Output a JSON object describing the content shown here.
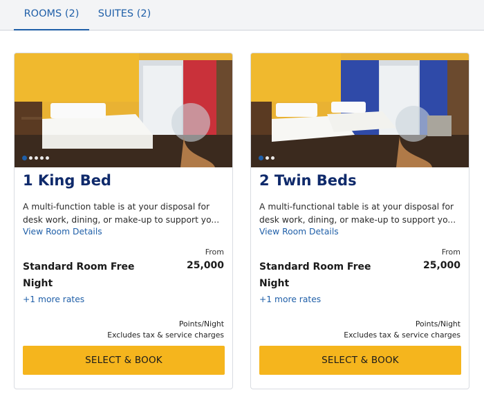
{
  "tabs": [
    {
      "label": "ROOMS (2)",
      "active": true
    },
    {
      "label": "SUITES (2)",
      "active": false
    }
  ],
  "rooms": [
    {
      "title": "1 King Bed",
      "description": "A multi-function table is at your disposal for desk work, dining, or make-up to support yo...",
      "view_details": "View Room Details",
      "from_label": "From",
      "points": "25,000",
      "rate_name": "Standard Room Free Night",
      "more_rates": "+1 more rates",
      "per_night": "Points/Night",
      "excludes": "Excludes tax & service charges",
      "cta": "SELECT & BOOK",
      "photo_dots": 5,
      "photo_active_dot": 0,
      "mural_color": "#c9313a"
    },
    {
      "title": "2 Twin Beds",
      "description": "A multi-functional table is at your disposal for desk work, dining, or make-up to support yo...",
      "view_details": "View Room Details",
      "from_label": "From",
      "points": "25,000",
      "rate_name": "Standard Room Free Night",
      "more_rates": "+1 more rates",
      "per_night": "Points/Night",
      "excludes": "Excludes tax & service charges",
      "cta": "SELECT & BOOK",
      "photo_dots": 3,
      "photo_active_dot": 0,
      "mural_color": "#2f4aa8"
    }
  ],
  "colors": {
    "accent": "#1f5fa8",
    "title": "#0f2a6b",
    "button": "#f5b51d"
  }
}
